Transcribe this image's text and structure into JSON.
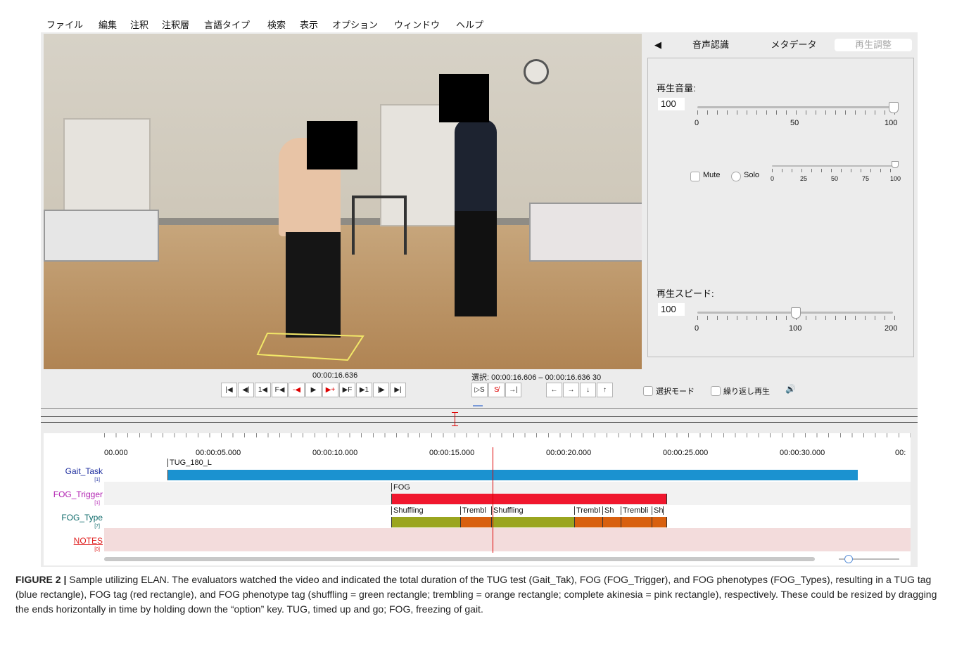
{
  "menu": [
    "ファイル",
    "編集",
    "注釈",
    "注釈層",
    "言語タイプ",
    "検索",
    "表示",
    "オプション",
    "ウィンドウ",
    "ヘルプ"
  ],
  "tabs": {
    "arrow": "◀",
    "speech": "音声認識",
    "metadata": "メタデータ",
    "playback": "再生調整"
  },
  "volume": {
    "label": "再生音量:",
    "value": "100",
    "level": 100,
    "ticks": [
      "0",
      "50",
      "100"
    ]
  },
  "mute_solo": {
    "mute": "Mute",
    "solo": "Solo",
    "ticks": [
      "0",
      "25",
      "50",
      "75",
      "100"
    ]
  },
  "speed": {
    "label": "再生スピード:",
    "value": "100",
    "level": 100,
    "ticks": [
      "0",
      "100",
      "200"
    ]
  },
  "player": {
    "current_time": "00:00:16.636",
    "selection": "選択: 00:00:16.606 – 00:00:16.636  30",
    "buttons": [
      "|◀",
      "◀|",
      "1◀",
      "F◀",
      "-◀",
      "▶",
      "▶+",
      "▶F",
      "▶1",
      "|▶",
      "▶|"
    ],
    "selection_buttons": [
      "▷S",
      "S̸",
      "→|"
    ],
    "arrows": [
      "←",
      "→",
      "↓",
      "↑"
    ],
    "selection_mode": "選択モード",
    "loop": "繰り返し再生",
    "speaker": "🔊"
  },
  "timeline": {
    "ruler": [
      "00.000",
      "00:00:05.000",
      "00:00:10.000",
      "00:00:15.000",
      "00:00:20.000",
      "00:00:25.000",
      "00:00:30.000",
      "00:"
    ],
    "tiers": [
      {
        "name": "Gait_Task",
        "count": "[1]",
        "color": "#1f2f9f"
      },
      {
        "name": "FOG_Trigger",
        "count": "[1]",
        "color": "#b01eb0"
      },
      {
        "name": "FOG_Type",
        "count": "[7]",
        "color": "#0f6b6b"
      },
      {
        "name": "NOTES",
        "count": "[0]",
        "color": "#e02020"
      }
    ],
    "annotations": {
      "gait": "TUG_180_L",
      "trigger": "FOG",
      "types": [
        "Shuffling",
        "Trembl",
        "Shuffling",
        "Trembl",
        "Sh",
        "Trembli",
        "Sh"
      ]
    },
    "colors": {
      "blue": "#1b92d0",
      "red": "#f0172e",
      "green": "#9aa51f",
      "orange": "#d8600f",
      "pink": "#f3dcdc"
    }
  },
  "caption": {
    "label": "FIGURE 2 |",
    "text": " Sample utilizing ELAN. The evaluators watched the video and indicated the total duration of the TUG test (Gait_Tak), FOG (FOG_Trigger), and FOG phenotypes (FOG_Types), resulting in a TUG tag (blue rectangle), FOG tag (red rectangle), and FOG phenotype tag (shuffling = green rectangle; trembling = orange rectangle; complete akinesia = pink rectangle), respectively. These could be resized by dragging the ends horizontally in time by holding down the “option” key. TUG, timed up and go; FOG, freezing of gait."
  }
}
